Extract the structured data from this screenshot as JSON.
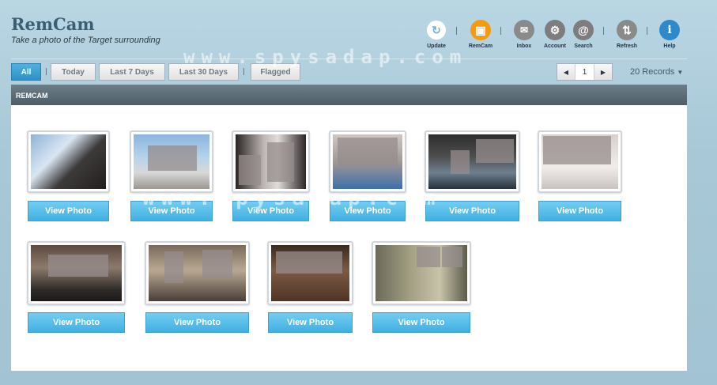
{
  "header": {
    "title": "RemCam",
    "subtitle": "Take a photo of the Target surrounding"
  },
  "toolbar": [
    {
      "label": "Update",
      "icon": "refresh-cycle-icon",
      "color": "#ffffff"
    },
    {
      "label": "RemCam",
      "icon": "camera-icon",
      "color": "#f39c12"
    },
    {
      "label": "Inbox",
      "icon": "envelope-icon",
      "color": "#8a8a8a"
    },
    {
      "label": "Account",
      "icon": "gear-icon",
      "color": "#7d7d7d"
    },
    {
      "label": "Search",
      "icon": "at-search-icon",
      "color": "#7d7d7d"
    },
    {
      "label": "Refresh",
      "icon": "refresh-arrows-icon",
      "color": "#8a8a8a"
    },
    {
      "label": "Help",
      "icon": "info-icon",
      "color": "#2e89c9"
    }
  ],
  "filters": [
    {
      "label": "All",
      "active": true
    },
    {
      "label": "Today",
      "active": false
    },
    {
      "label": "Last 7 Days",
      "active": false
    },
    {
      "label": "Last 30 Days",
      "active": false
    },
    {
      "label": "Flagged",
      "active": false
    }
  ],
  "pager": {
    "current_page": "1"
  },
  "records_label": "20 Records",
  "panel_title": "REMCAM",
  "photos": [
    {
      "button": "View Photo"
    },
    {
      "button": "View Photo"
    },
    {
      "button": "View Photo"
    },
    {
      "button": "View Photo"
    },
    {
      "button": "View Photo"
    },
    {
      "button": "View Photo"
    },
    {
      "button": "View Photo"
    },
    {
      "button": "View Photo"
    },
    {
      "button": "View Photo"
    },
    {
      "button": "View Photo"
    }
  ],
  "watermark": "www.spysadap.com"
}
